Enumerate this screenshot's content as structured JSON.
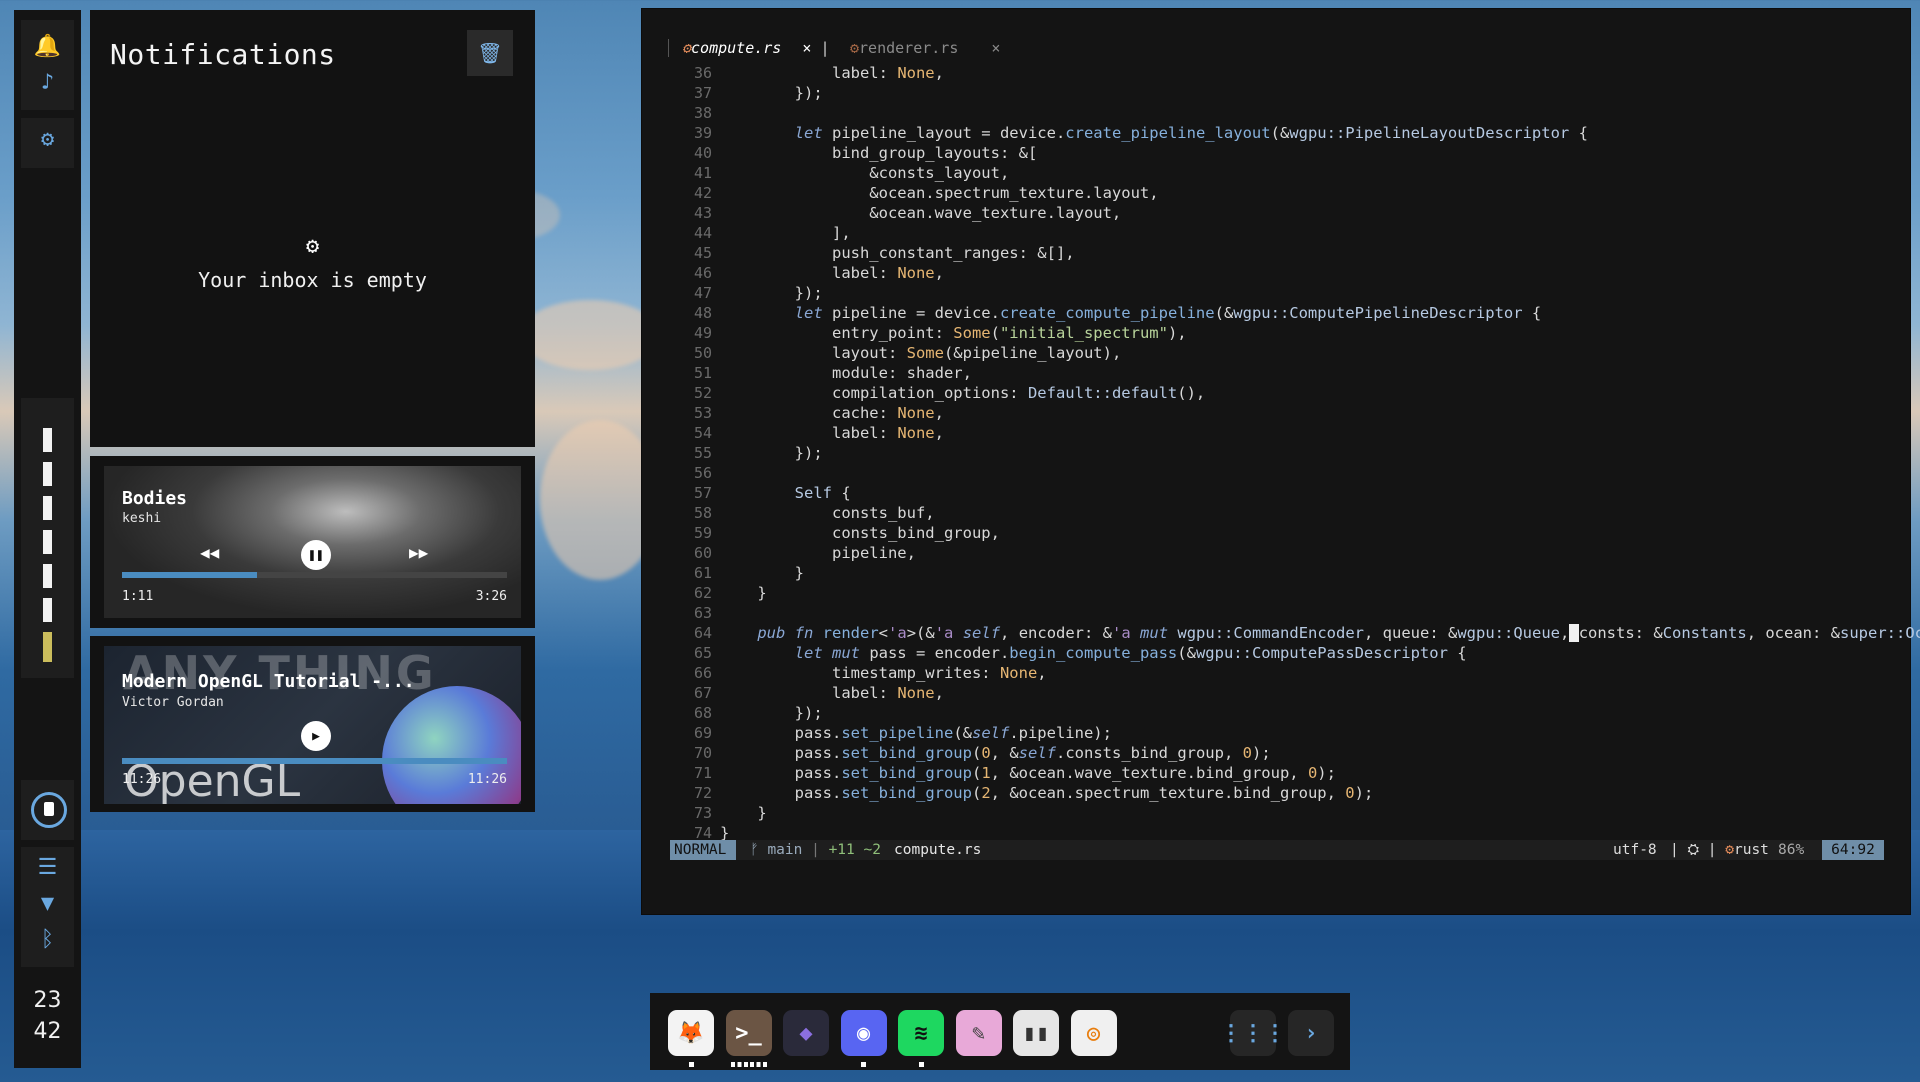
{
  "sidebar": {
    "icons": [
      "bell-icon",
      "music-note-icon",
      "gear-icon",
      "power-icon",
      "sliders-icon",
      "wifi-icon",
      "bluetooth-icon"
    ],
    "workspaces": 7,
    "active_workspace": 7,
    "clock": {
      "hour": "23",
      "minute": "42"
    }
  },
  "notifications": {
    "title": "Notifications",
    "empty_text": "Your inbox is empty",
    "empty_icon": "gear-icon",
    "clear_icon": "trash-icon"
  },
  "players": [
    {
      "title": "Bodies",
      "artist": "keshi",
      "position": "1:11",
      "duration": "3:26",
      "progress": 0.35,
      "state": "playing"
    },
    {
      "title": "Modern OpenGL Tutorial -...",
      "artist": "Victor Gordan",
      "position": "11:26",
      "duration": "11:26",
      "progress": 1.0,
      "state": "paused"
    }
  ],
  "editor": {
    "tabs": [
      {
        "name": "compute.rs",
        "active": true,
        "close": "×"
      },
      {
        "name": "renderer.rs",
        "active": false,
        "close": "×"
      }
    ],
    "first_line": 36,
    "status": {
      "mode": "NORMAL",
      "branch": "main",
      "diff": "+11 ~2",
      "file": "compute.rs",
      "encoding": "utf-8",
      "language": "rust",
      "percent": "86%",
      "position": "64:92"
    }
  },
  "dock": {
    "apps": [
      {
        "name": "firefox",
        "icon": "firefox-icon",
        "bg": "#f3f3f3",
        "running": 1
      },
      {
        "name": "terminal",
        "icon": "terminal-icon",
        "bg": "#6b5544",
        "running": 6
      },
      {
        "name": "obsidian",
        "icon": "obsidian-icon",
        "bg": "#2a2a3a",
        "running": 0
      },
      {
        "name": "discord",
        "icon": "discord-icon",
        "bg": "#5865f2",
        "running": 1
      },
      {
        "name": "spotify",
        "icon": "spotify-icon",
        "bg": "#1ed760",
        "running": 1
      },
      {
        "name": "paint",
        "icon": "paint-icon",
        "bg": "#e8a9d8",
        "running": 0
      },
      {
        "name": "notes",
        "icon": "notes-icon",
        "bg": "#e6e6e6",
        "running": 0
      },
      {
        "name": "blender",
        "icon": "blender-icon",
        "bg": "#f0f0f0",
        "running": 0
      }
    ],
    "launcher_icon": "grid-icon",
    "more_icon": "chevron-right-icon"
  }
}
